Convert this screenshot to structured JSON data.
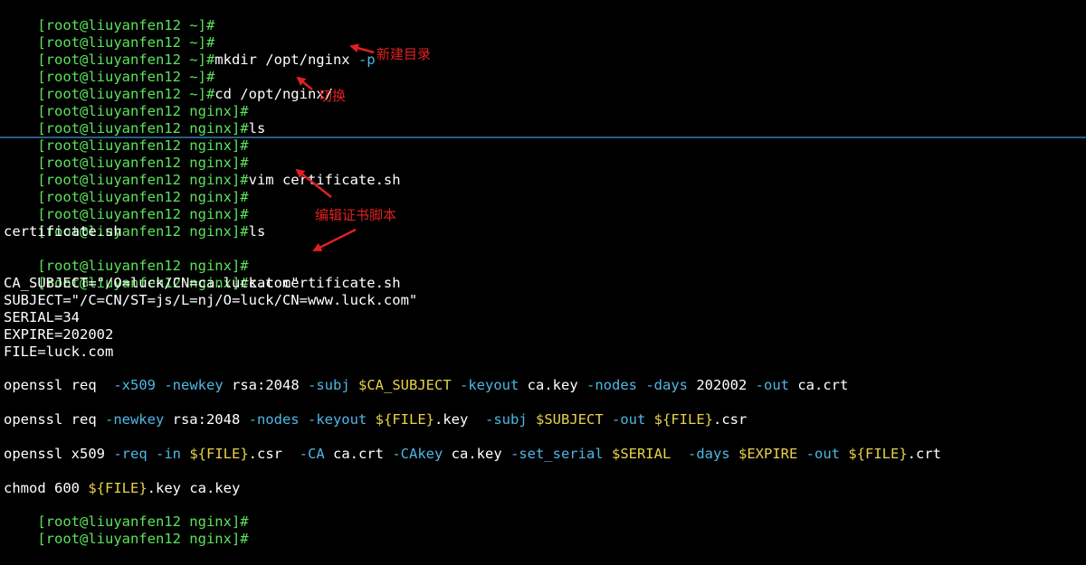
{
  "prompt": "[root@liuyanfen12 ~]#",
  "prompt_nginx": "[root@liuyanfen12 nginx]#",
  "cmd_mkdir": "mkdir /opt/nginx ",
  "cmd_mkdir_flag": "-p",
  "cmd_cd": "cd /opt/nginx/",
  "cmd_ls": "ls",
  "cmd_vim": "vim certificate.sh",
  "ls_output": "certificate.sh",
  "cmd_cat": "cat certificate.sh",
  "file_lines": {
    "ca_subject": "CA_SUBJECT=\"/O=luck/CN=ca.luck.com\"",
    "subject": "SUBJECT=\"/C=CN/ST=js/L=nj/O=luck/CN=www.luck.com\"",
    "serial": "SERIAL=34",
    "expire": "EXPIRE=202002",
    "file": "FILE=luck.com",
    "ossl1": [
      {
        "t": "openssl req  ",
        "c": "w"
      },
      {
        "t": "-x509",
        "c": "c"
      },
      {
        "t": " ",
        "c": "w"
      },
      {
        "t": "-newkey",
        "c": "c"
      },
      {
        "t": " rsa:2048 ",
        "c": "w"
      },
      {
        "t": "-subj",
        "c": "c"
      },
      {
        "t": " ",
        "c": "w"
      },
      {
        "t": "$CA_SUBJECT",
        "c": "y"
      },
      {
        "t": " ",
        "c": "w"
      },
      {
        "t": "-keyout",
        "c": "c"
      },
      {
        "t": " ca.key ",
        "c": "w"
      },
      {
        "t": "-nodes",
        "c": "c"
      },
      {
        "t": " ",
        "c": "w"
      },
      {
        "t": "-days",
        "c": "c"
      },
      {
        "t": " 202002 ",
        "c": "w"
      },
      {
        "t": "-out",
        "c": "c"
      },
      {
        "t": " ca.crt",
        "c": "w"
      }
    ],
    "ossl2": [
      {
        "t": "openssl req ",
        "c": "w"
      },
      {
        "t": "-newkey",
        "c": "c"
      },
      {
        "t": " rsa:2048 ",
        "c": "w"
      },
      {
        "t": "-nodes",
        "c": "c"
      },
      {
        "t": " ",
        "c": "w"
      },
      {
        "t": "-keyout",
        "c": "c"
      },
      {
        "t": " ",
        "c": "w"
      },
      {
        "t": "${FILE}",
        "c": "y"
      },
      {
        "t": ".key  ",
        "c": "w"
      },
      {
        "t": "-subj",
        "c": "c"
      },
      {
        "t": " ",
        "c": "w"
      },
      {
        "t": "$SUBJECT",
        "c": "y"
      },
      {
        "t": " ",
        "c": "w"
      },
      {
        "t": "-out",
        "c": "c"
      },
      {
        "t": " ",
        "c": "w"
      },
      {
        "t": "${FILE}",
        "c": "y"
      },
      {
        "t": ".csr",
        "c": "w"
      }
    ],
    "ossl3": [
      {
        "t": "openssl x509 ",
        "c": "w"
      },
      {
        "t": "-req",
        "c": "c"
      },
      {
        "t": " ",
        "c": "w"
      },
      {
        "t": "-in",
        "c": "c"
      },
      {
        "t": " ",
        "c": "w"
      },
      {
        "t": "${FILE}",
        "c": "y"
      },
      {
        "t": ".csr  ",
        "c": "w"
      },
      {
        "t": "-CA",
        "c": "c"
      },
      {
        "t": " ca.crt ",
        "c": "w"
      },
      {
        "t": "-CAkey",
        "c": "c"
      },
      {
        "t": " ca.key ",
        "c": "w"
      },
      {
        "t": "-set_serial",
        "c": "c"
      },
      {
        "t": " ",
        "c": "w"
      },
      {
        "t": "$SERIAL",
        "c": "y"
      },
      {
        "t": "  ",
        "c": "w"
      },
      {
        "t": "-days",
        "c": "c"
      },
      {
        "t": " ",
        "c": "w"
      },
      {
        "t": "$EXPIRE",
        "c": "y"
      },
      {
        "t": " ",
        "c": "w"
      },
      {
        "t": "-out",
        "c": "c"
      },
      {
        "t": " ",
        "c": "w"
      },
      {
        "t": "${FILE}",
        "c": "y"
      },
      {
        "t": ".crt",
        "c": "w"
      }
    ],
    "chmod": [
      {
        "t": "chmod 600 ",
        "c": "w"
      },
      {
        "t": "${FILE}",
        "c": "y"
      },
      {
        "t": ".key ca.key",
        "c": "w"
      }
    ]
  },
  "annotations": {
    "new_dir": "新建目录",
    "switch": "切换",
    "edit_script": "编辑证书脚本"
  },
  "colors": {
    "background": "#000000",
    "prompt": "#5ce35c",
    "option": "#4fb7e6",
    "variable": "#e8d24a",
    "annotation": "#e02020",
    "separator": "#2b5b8a"
  }
}
